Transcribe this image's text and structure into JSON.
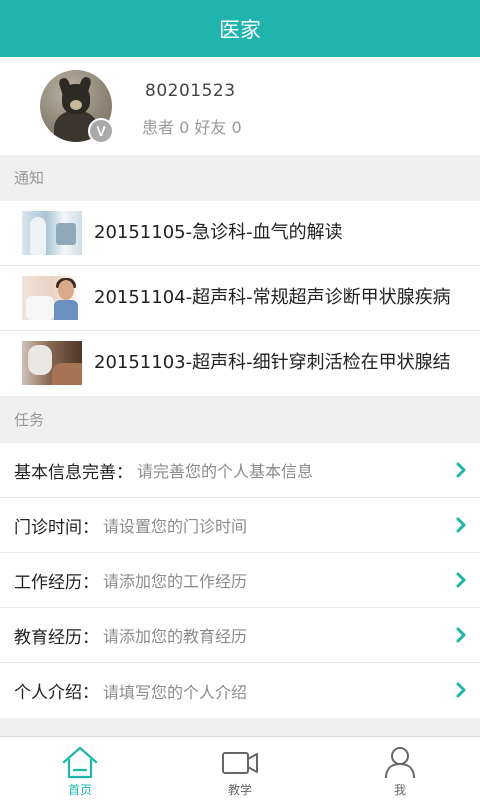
{
  "app": {
    "title": "医家",
    "accent_color": "#1fb5ad"
  },
  "profile": {
    "avatar_icon": "dog-photo-avatar",
    "badge": "V",
    "user_id": "80201523",
    "stats": "患者 0 好友 0"
  },
  "notices": {
    "section_title": "通知",
    "items": [
      {
        "text": "20151105-急诊科-血气的解读",
        "thumbnail": "clinic-photo"
      },
      {
        "text": "20151104-超声科-常规超声诊断甲状腺疾病",
        "thumbnail": "neck-exam-photo"
      },
      {
        "text": "20151103-超声科-细针穿刺活检在甲状腺结",
        "thumbnail": "gloved-hands-photo"
      }
    ]
  },
  "tasks": {
    "section_title": "任务",
    "items": [
      {
        "label": "基本信息完善：",
        "hint": "请完善您的个人基本信息"
      },
      {
        "label": "门诊时间：",
        "hint": "请设置您的门诊时间"
      },
      {
        "label": "工作经历：",
        "hint": "请添加您的工作经历"
      },
      {
        "label": "教育经历：",
        "hint": "请添加您的教育经历"
      },
      {
        "label": "个人介绍：",
        "hint": "请填写您的个人介绍"
      }
    ]
  },
  "tabbar": {
    "tabs": [
      {
        "label": "首页",
        "icon": "home-icon",
        "active": true
      },
      {
        "label": "教学",
        "icon": "video-camera-icon",
        "active": false
      },
      {
        "label": "我",
        "icon": "person-icon",
        "active": false
      }
    ]
  }
}
